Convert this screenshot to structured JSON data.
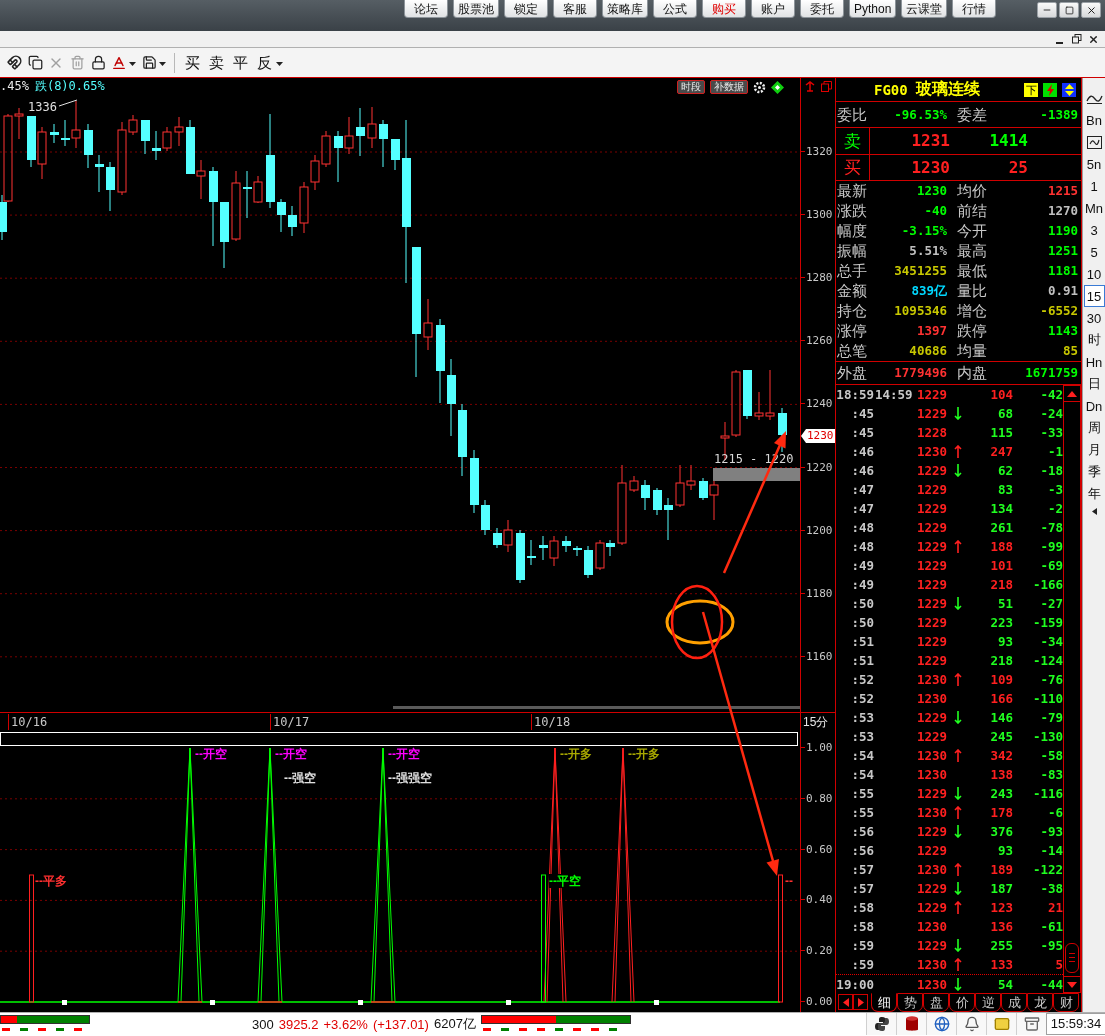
{
  "menu": [
    {
      "label": "论坛",
      "highlighted": false
    },
    {
      "label": "股票池",
      "highlighted": false
    },
    {
      "label": "锁定",
      "highlighted": false
    },
    {
      "label": "客服",
      "highlighted": false
    },
    {
      "label": "策略库",
      "highlighted": false
    },
    {
      "label": "公式",
      "highlighted": false
    },
    {
      "label": "购买",
      "highlighted": true
    },
    {
      "label": "账户",
      "highlighted": false
    },
    {
      "label": "委托",
      "highlighted": false
    },
    {
      "label": "Python",
      "highlighted": false
    },
    {
      "label": "云课堂",
      "highlighted": false
    },
    {
      "label": "行情",
      "highlighted": false
    }
  ],
  "toolbar": {
    "trade_buttons": [
      "买",
      "卖",
      "平",
      "反"
    ]
  },
  "chart": {
    "change_text": ".45%",
    "status_text": "跌(8)0.65%",
    "buttons": [
      "时段",
      "补数据"
    ],
    "high_label": "1336",
    "price_ticks": [
      "1320",
      "1300",
      "1280",
      "1260",
      "1240",
      "1220",
      "1200",
      "1180",
      "1160"
    ],
    "price_tag": "1230",
    "range_label": "1215 - 1220",
    "dates": [
      "10/16",
      "10/17",
      "10/18"
    ],
    "period": "15分"
  },
  "signal_panel": {
    "ticks": [
      "1.00",
      "0.80",
      "0.60",
      "0.40",
      "0.20",
      "0.00"
    ],
    "labels": [
      {
        "text": "--开空",
        "color": "#ff00ff"
      },
      {
        "text": "--开空",
        "color": "#ff00ff"
      },
      {
        "text": "--开空",
        "color": "#ff00ff"
      },
      {
        "text": "--开多",
        "color": "#a8a800"
      },
      {
        "text": "--开多",
        "color": "#a8a800"
      },
      {
        "text": "--强空",
        "color": "#e0e0e0"
      },
      {
        "text": "--强强空",
        "color": "#e0e0e0"
      },
      {
        "text": "--平多",
        "color": "#ff3030"
      },
      {
        "text": "--平空",
        "color": "#00ff00"
      },
      {
        "text": "--",
        "color": "#ff3030"
      }
    ]
  },
  "quote": {
    "code": "FG00",
    "name": "玻璃连续",
    "flag": "下",
    "ratio": [
      {
        "label": "委比",
        "value": "-96.53%",
        "color": "#00ff00"
      },
      {
        "label": "委差",
        "value": "-1389",
        "color": "#00ff00"
      }
    ],
    "book": [
      {
        "label": "卖",
        "price": "1231",
        "volume": "1414",
        "sell": true
      },
      {
        "label": "买",
        "price": "1230",
        "volume": "25",
        "sell": false
      }
    ],
    "stats": [
      {
        "label": "最新",
        "value": "1230",
        "color": "#00ff00"
      },
      {
        "label": "均价",
        "value": "1215",
        "color": "#ff3232"
      },
      {
        "label": "涨跌",
        "value": "-40",
        "color": "#00ff00"
      },
      {
        "label": "前结",
        "value": "1270",
        "color": "#c0c0c0"
      },
      {
        "label": "幅度",
        "value": "-3.15%",
        "color": "#00ff00"
      },
      {
        "label": "今开",
        "value": "1190",
        "color": "#00ff00"
      },
      {
        "label": "振幅",
        "value": "5.51%",
        "color": "#c0c0c0"
      },
      {
        "label": "最高",
        "value": "1251",
        "color": "#00ff00"
      },
      {
        "label": "总手",
        "value": "3451255",
        "color": "#c8c800"
      },
      {
        "label": "最低",
        "value": "1181",
        "color": "#00ff00"
      },
      {
        "label": "金额",
        "value": "839亿",
        "color": "#00d8ff"
      },
      {
        "label": "量比",
        "value": "0.91",
        "color": "#c0c0c0"
      },
      {
        "label": "持仓",
        "value": "1095346",
        "color": "#c8c800"
      },
      {
        "label": "增仓",
        "value": "-6552",
        "color": "#c8c800"
      },
      {
        "label": "涨停",
        "value": "1397",
        "color": "#ff3232"
      },
      {
        "label": "跌停",
        "value": "1143",
        "color": "#00ff00"
      },
      {
        "label": "总笔",
        "value": "40686",
        "color": "#c8c800"
      },
      {
        "label": "均量",
        "value": "85",
        "color": "#c8c800"
      }
    ],
    "flow": [
      {
        "label": "外盘",
        "value": "1779496",
        "color": "#ff3232"
      },
      {
        "label": "内盘",
        "value": "1671759",
        "color": "#00ff00"
      }
    ]
  },
  "trades": [
    {
      "time": "18:59",
      "time_extra": "14:59",
      "price": "1229",
      "up_tick": false,
      "down_tick": false,
      "volume": "104",
      "volume_up": true,
      "change": "-42",
      "change_up": false,
      "divider_above": false
    },
    {
      "time": ":45",
      "price": "1229",
      "up_tick": false,
      "down_tick": true,
      "volume": "68",
      "volume_up": false,
      "change": "-24",
      "change_up": false,
      "divider_above": false
    },
    {
      "time": ":45",
      "price": "1228",
      "up_tick": false,
      "down_tick": false,
      "volume": "115",
      "volume_up": false,
      "change": "-33",
      "change_up": false,
      "divider_above": false
    },
    {
      "time": ":46",
      "price": "1230",
      "up_tick": true,
      "down_tick": false,
      "volume": "247",
      "volume_up": true,
      "change": "-1",
      "change_up": false,
      "divider_above": false
    },
    {
      "time": ":46",
      "price": "1229",
      "up_tick": false,
      "down_tick": true,
      "volume": "62",
      "volume_up": false,
      "change": "-18",
      "change_up": false,
      "divider_above": false
    },
    {
      "time": ":47",
      "price": "1229",
      "up_tick": false,
      "down_tick": false,
      "volume": "83",
      "volume_up": false,
      "change": "-3",
      "change_up": false,
      "divider_above": false
    },
    {
      "time": ":47",
      "price": "1229",
      "up_tick": false,
      "down_tick": false,
      "volume": "134",
      "volume_up": false,
      "change": "-2",
      "change_up": false,
      "divider_above": false
    },
    {
      "time": ":48",
      "price": "1229",
      "up_tick": false,
      "down_tick": false,
      "volume": "261",
      "volume_up": false,
      "change": "-78",
      "change_up": false,
      "divider_above": false
    },
    {
      "time": ":48",
      "price": "1229",
      "up_tick": true,
      "down_tick": false,
      "volume": "188",
      "volume_up": true,
      "change": "-99",
      "change_up": false,
      "divider_above": false
    },
    {
      "time": ":49",
      "price": "1229",
      "up_tick": false,
      "down_tick": false,
      "volume": "101",
      "volume_up": true,
      "change": "-69",
      "change_up": false,
      "divider_above": false
    },
    {
      "time": ":49",
      "price": "1229",
      "up_tick": false,
      "down_tick": false,
      "volume": "218",
      "volume_up": true,
      "change": "-166",
      "change_up": false,
      "divider_above": false
    },
    {
      "time": ":50",
      "price": "1229",
      "up_tick": false,
      "down_tick": true,
      "volume": "51",
      "volume_up": false,
      "change": "-27",
      "change_up": false,
      "divider_above": false
    },
    {
      "time": ":50",
      "price": "1229",
      "up_tick": false,
      "down_tick": false,
      "volume": "223",
      "volume_up": false,
      "change": "-159",
      "change_up": false,
      "divider_above": false
    },
    {
      "time": ":51",
      "price": "1229",
      "up_tick": false,
      "down_tick": false,
      "volume": "93",
      "volume_up": false,
      "change": "-34",
      "change_up": false,
      "divider_above": false
    },
    {
      "time": ":51",
      "price": "1229",
      "up_tick": false,
      "down_tick": false,
      "volume": "218",
      "volume_up": false,
      "change": "-124",
      "change_up": false,
      "divider_above": false
    },
    {
      "time": ":52",
      "price": "1230",
      "up_tick": true,
      "down_tick": false,
      "volume": "109",
      "volume_up": true,
      "change": "-76",
      "change_up": false,
      "divider_above": false
    },
    {
      "time": ":52",
      "price": "1230",
      "up_tick": false,
      "down_tick": false,
      "volume": "166",
      "volume_up": true,
      "change": "-110",
      "change_up": false,
      "divider_above": false
    },
    {
      "time": ":53",
      "price": "1229",
      "up_tick": false,
      "down_tick": true,
      "volume": "146",
      "volume_up": false,
      "change": "-79",
      "change_up": false,
      "divider_above": false
    },
    {
      "time": ":53",
      "price": "1229",
      "up_tick": false,
      "down_tick": false,
      "volume": "245",
      "volume_up": false,
      "change": "-130",
      "change_up": false,
      "divider_above": false
    },
    {
      "time": ":54",
      "price": "1230",
      "up_tick": true,
      "down_tick": false,
      "volume": "342",
      "volume_up": true,
      "change": "-58",
      "change_up": false,
      "divider_above": false
    },
    {
      "time": ":54",
      "price": "1230",
      "up_tick": false,
      "down_tick": false,
      "volume": "138",
      "volume_up": true,
      "change": "-83",
      "change_up": false,
      "divider_above": false
    },
    {
      "time": ":55",
      "price": "1229",
      "up_tick": false,
      "down_tick": true,
      "volume": "243",
      "volume_up": false,
      "change": "-116",
      "change_up": false,
      "divider_above": false
    },
    {
      "time": ":55",
      "price": "1230",
      "up_tick": true,
      "down_tick": false,
      "volume": "178",
      "volume_up": true,
      "change": "-6",
      "change_up": false,
      "divider_above": false
    },
    {
      "time": ":56",
      "price": "1229",
      "up_tick": false,
      "down_tick": true,
      "volume": "376",
      "volume_up": false,
      "change": "-93",
      "change_up": false,
      "divider_above": false
    },
    {
      "time": ":56",
      "price": "1229",
      "up_tick": false,
      "down_tick": false,
      "volume": "93",
      "volume_up": false,
      "change": "-14",
      "change_up": false,
      "divider_above": false
    },
    {
      "time": ":57",
      "price": "1230",
      "up_tick": true,
      "down_tick": false,
      "volume": "189",
      "volume_up": true,
      "change": "-122",
      "change_up": false,
      "divider_above": false
    },
    {
      "time": ":57",
      "price": "1229",
      "up_tick": false,
      "down_tick": true,
      "volume": "187",
      "volume_up": false,
      "change": "-38",
      "change_up": false,
      "divider_above": false
    },
    {
      "time": ":58",
      "price": "1229",
      "up_tick": true,
      "down_tick": false,
      "volume": "123",
      "volume_up": true,
      "change": "21",
      "change_up": true,
      "divider_above": false
    },
    {
      "time": ":58",
      "price": "1230",
      "up_tick": false,
      "down_tick": false,
      "volume": "136",
      "volume_up": true,
      "change": "-61",
      "change_up": false,
      "divider_above": false
    },
    {
      "time": ":59",
      "price": "1229",
      "up_tick": false,
      "down_tick": true,
      "volume": "255",
      "volume_up": false,
      "change": "-95",
      "change_up": false,
      "divider_above": false
    },
    {
      "time": ":59",
      "price": "1230",
      "up_tick": true,
      "down_tick": false,
      "volume": "133",
      "volume_up": true,
      "change": "5",
      "change_up": true,
      "divider_above": false
    },
    {
      "time": "19:00",
      "price": "1230",
      "up_tick": false,
      "down_tick": true,
      "volume": "54",
      "volume_up": false,
      "change": "-44",
      "change_up": false,
      "divider_above": true
    }
  ],
  "detail_tabs": [
    {
      "label": "细",
      "selected": true
    },
    {
      "label": "势",
      "selected": false
    },
    {
      "label": "盘",
      "selected": false
    },
    {
      "label": "价",
      "selected": false
    },
    {
      "label": "逆",
      "selected": false
    },
    {
      "label": "成",
      "selected": false
    },
    {
      "label": "龙",
      "selected": false
    },
    {
      "label": "财",
      "selected": false
    }
  ],
  "periods": [
    {
      "kind": "curve",
      "selected": false
    },
    {
      "kind": "text",
      "label": "Bn",
      "selected": false
    },
    {
      "kind": "framed",
      "selected": false
    },
    {
      "kind": "text",
      "label": "5n",
      "selected": false
    },
    {
      "kind": "text",
      "label": "1",
      "selected": false
    },
    {
      "kind": "text",
      "label": "Mn",
      "selected": false
    },
    {
      "kind": "text",
      "label": "3",
      "selected": false
    },
    {
      "kind": "text",
      "label": "5",
      "selected": false
    },
    {
      "kind": "text",
      "label": "10",
      "selected": false
    },
    {
      "kind": "text",
      "label": "15",
      "selected": true
    },
    {
      "kind": "text",
      "label": "30",
      "selected": false
    },
    {
      "kind": "text",
      "label": "时",
      "selected": false
    },
    {
      "kind": "text",
      "label": "Hn",
      "selected": false
    },
    {
      "kind": "text",
      "label": "日",
      "selected": false
    },
    {
      "kind": "text",
      "label": "Dn",
      "selected": false
    },
    {
      "kind": "text",
      "label": "周",
      "selected": false
    },
    {
      "kind": "text",
      "label": "月",
      "selected": false
    },
    {
      "kind": "text",
      "label": "季",
      "selected": false
    },
    {
      "kind": "text",
      "label": "年",
      "selected": false
    }
  ],
  "status_bar": {
    "breadth": [
      {
        "level": 0.18
      },
      {
        "level": 0.5
      }
    ],
    "index_code": "300",
    "index_price": "3925.2",
    "index_change_pct": "+3.62%",
    "index_change": "(+137.01)",
    "turnover": "6207亿",
    "clock": "15:59:34"
  }
}
